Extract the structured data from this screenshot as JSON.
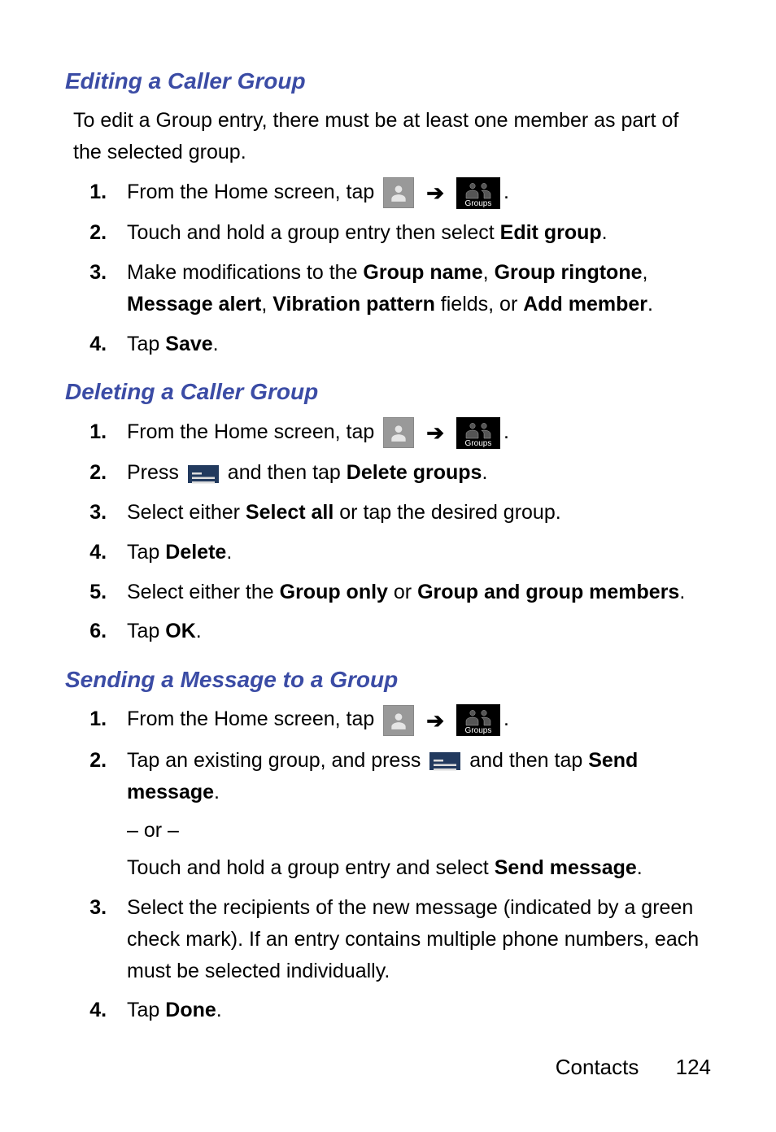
{
  "footer": {
    "section": "Contacts",
    "page": "124"
  },
  "arrow": "➔",
  "groupsLabel": "Groups",
  "sections": {
    "edit": {
      "title": "Editing a Caller Group",
      "intro": "To edit a Group entry, there must be at least one member as part of the selected group.",
      "s1_a": "From the Home screen, tap",
      "s2_a": "Touch and hold a group entry then select ",
      "s2_b": "Edit group",
      "s3_a": "Make modifications to the ",
      "s3_b": "Group name",
      "s3_c": "Group ringtone",
      "s3_d": "Message alert",
      "s3_e": "Vibration pattern",
      "s3_f": " fields, or ",
      "s3_g": "Add member",
      "s4_a": "Tap ",
      "s4_b": "Save"
    },
    "del": {
      "title": "Deleting a Caller Group",
      "s1_a": "From the Home screen, tap",
      "s2_a": "Press ",
      "s2_b": " and then tap ",
      "s2_c": "Delete groups",
      "s3_a": "Select either ",
      "s3_b": "Select all",
      "s3_c": " or tap the desired group.",
      "s4_a": "Tap ",
      "s4_b": "Delete",
      "s5_a": "Select either the ",
      "s5_b": "Group only",
      "s5_c": " or ",
      "s5_d": "Group and group members",
      "s6_a": "Tap ",
      "s6_b": "OK"
    },
    "send": {
      "title": "Sending a Message to a Group",
      "s1_a": "From the Home screen, tap",
      "s2_a": "Tap an existing group, and press ",
      "s2_b": " and then tap ",
      "s2_c": "Send message",
      "or": "– or –",
      "s2_d": "Touch and hold a group entry and select ",
      "s2_e": "Send message",
      "s3": "Select the recipients of the new message (indicated by a green check mark). If an entry contains multiple phone numbers, each must be selected individually.",
      "s4_a": "Tap ",
      "s4_b": "Done"
    }
  }
}
